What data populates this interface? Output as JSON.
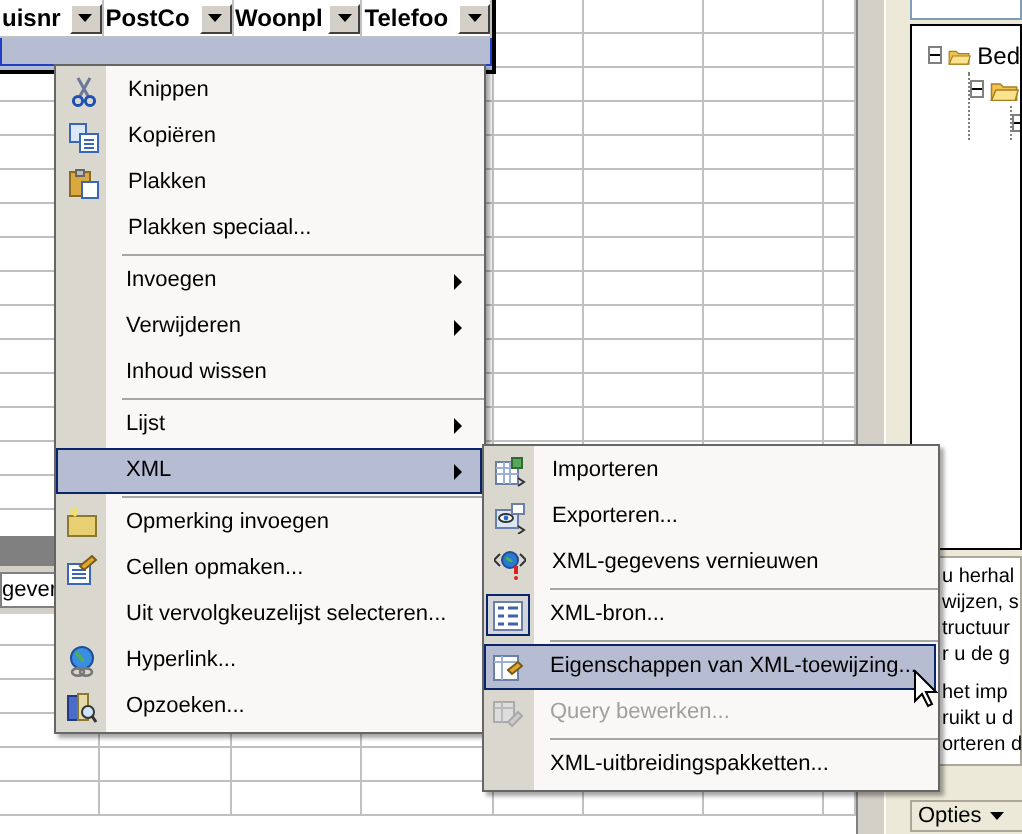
{
  "sheet": {
    "columns": [
      {
        "label": "uisnr"
      },
      {
        "label": "PostCo"
      },
      {
        "label": "Woonpl"
      },
      {
        "label": "Telefoo"
      }
    ],
    "sheet_tab": "gever"
  },
  "task_pane": {
    "tree": [
      {
        "label": "Bed",
        "expanded": true,
        "children": [
          {
            "expanded": true,
            "children": [
              {
                "expanded": true
              }
            ]
          }
        ]
      }
    ],
    "help_paragraphs": [
      [
        "u herhal",
        "wijzen, s",
        "tructuur",
        "r u de g"
      ],
      [
        "het imp",
        "ruikt u d",
        "orteren d"
      ]
    ],
    "options_button": "Opties"
  },
  "context_menu": {
    "groups": [
      [
        {
          "label": "Knippen",
          "submenu": false,
          "selected": false
        },
        {
          "label": "Kopiëren",
          "submenu": false,
          "selected": false
        },
        {
          "label": "Plakken",
          "submenu": false,
          "selected": false
        },
        {
          "label": "Plakken speciaal...",
          "submenu": false,
          "selected": false
        }
      ],
      [
        {
          "label": "Invoegen",
          "submenu": true,
          "selected": false
        },
        {
          "label": "Verwijderen",
          "submenu": true,
          "selected": false
        },
        {
          "label": "Inhoud wissen",
          "submenu": false,
          "selected": false
        }
      ],
      [
        {
          "label": "Lijst",
          "submenu": true,
          "selected": false
        },
        {
          "label": "XML",
          "submenu": true,
          "selected": true
        }
      ],
      [
        {
          "label": "Opmerking invoegen",
          "submenu": false,
          "selected": false
        },
        {
          "label": "Cellen opmaken...",
          "submenu": false,
          "selected": false
        },
        {
          "label": "Uit vervolgkeuzelijst selecteren...",
          "submenu": false,
          "selected": false
        },
        {
          "label": "Hyperlink...",
          "submenu": false,
          "selected": false
        },
        {
          "label": "Opzoeken...",
          "submenu": false,
          "selected": false
        }
      ]
    ]
  },
  "xml_submenu": {
    "groups": [
      [
        {
          "label": "Importeren",
          "selected": false,
          "disabled": false,
          "checked": false
        },
        {
          "label": "Exporteren...",
          "selected": false,
          "disabled": false,
          "checked": false
        },
        {
          "label": "XML-gegevens vernieuwen",
          "selected": false,
          "disabled": false,
          "checked": false
        }
      ],
      [
        {
          "label": "XML-bron...",
          "selected": false,
          "disabled": false,
          "checked": true
        }
      ],
      [
        {
          "label": "Eigenschappen van XML-toewijzing...",
          "selected": true,
          "disabled": false,
          "checked": false
        },
        {
          "label": "Query bewerken...",
          "selected": false,
          "disabled": true,
          "checked": false
        }
      ],
      [
        {
          "label": "XML-uitbreidingspakketten...",
          "selected": false,
          "disabled": false,
          "checked": false
        }
      ]
    ]
  }
}
